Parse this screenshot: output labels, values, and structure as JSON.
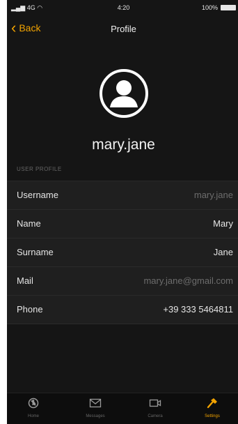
{
  "status_bar": {
    "carrier": "4G",
    "time": "4:20",
    "battery": "100%"
  },
  "nav": {
    "back_label": "Back",
    "title": "Profile"
  },
  "profile": {
    "username": "mary.jane"
  },
  "section_header": "USER PROFILE",
  "fields": [
    {
      "label": "Username",
      "value": "mary.jane"
    },
    {
      "label": "Name",
      "value": "Mary"
    },
    {
      "label": "Surname",
      "value": "Jane"
    },
    {
      "label": "Mail",
      "value": "mary.jane@gmail.com"
    },
    {
      "label": "Phone",
      "value": "+39 333 5464811"
    }
  ],
  "tabs": [
    {
      "label": "Home",
      "icon": "globe-icon"
    },
    {
      "label": "Messages",
      "icon": "mail-icon"
    },
    {
      "label": "Camera",
      "icon": "video-camera-icon"
    },
    {
      "label": "Settings",
      "icon": "hammer-icon"
    }
  ],
  "colors": {
    "accent": "#f2a300",
    "background": "#151515",
    "row_bg": "#1f1f1f"
  }
}
